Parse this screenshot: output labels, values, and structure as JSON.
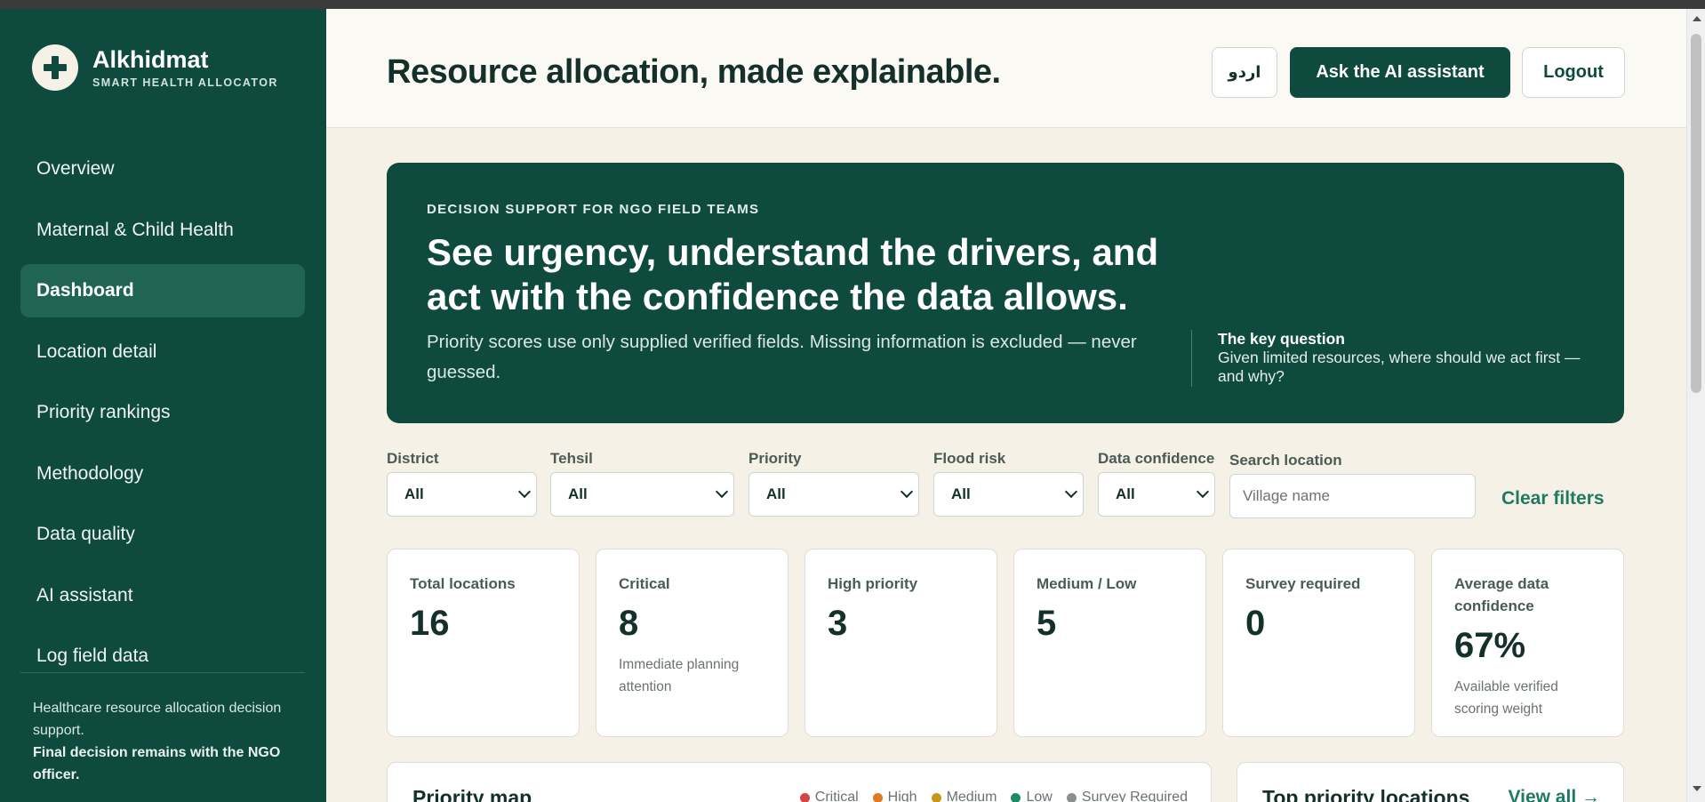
{
  "brand": {
    "name": "Alkhidmat",
    "subtitle": "SMART HEALTH ALLOCATOR"
  },
  "sidebar": {
    "items": [
      {
        "label": "Overview",
        "active": false
      },
      {
        "label": "Maternal & Child Health",
        "active": false
      },
      {
        "label": "Dashboard",
        "active": true
      },
      {
        "label": "Location detail",
        "active": false
      },
      {
        "label": "Priority rankings",
        "active": false
      },
      {
        "label": "Methodology",
        "active": false
      },
      {
        "label": "Data quality",
        "active": false
      },
      {
        "label": "AI assistant",
        "active": false
      },
      {
        "label": "Log field data",
        "active": false
      }
    ],
    "footer_text": "Healthcare resource allocation decision support.",
    "footer_strong": "Final decision remains with the NGO officer."
  },
  "header": {
    "title": "Resource allocation, made explainable.",
    "lang_label": "اردو",
    "ai_label": "Ask the AI assistant",
    "logout_label": "Logout"
  },
  "hero": {
    "kicker": "DECISION SUPPORT FOR NGO FIELD TEAMS",
    "title": "See urgency, understand the drivers, and act with the confidence the data allows.",
    "description": "Priority scores use only supplied verified fields. Missing information is excluded — never guessed.",
    "key_title": "The key question",
    "key_text": "Given limited resources, where should we act first — and why?"
  },
  "filters": {
    "district": {
      "label": "District",
      "value": "All"
    },
    "tehsil": {
      "label": "Tehsil",
      "value": "All"
    },
    "priority": {
      "label": "Priority",
      "value": "All"
    },
    "flood_risk": {
      "label": "Flood risk",
      "value": "All"
    },
    "data_confidence": {
      "label": "Data confidence",
      "value": "All"
    },
    "search": {
      "label": "Search location",
      "placeholder": "Village name"
    },
    "clear_label": "Clear filters"
  },
  "stats": [
    {
      "label": "Total locations",
      "value": "16",
      "note": ""
    },
    {
      "label": "Critical",
      "value": "8",
      "note": "Immediate planning attention"
    },
    {
      "label": "High priority",
      "value": "3",
      "note": ""
    },
    {
      "label": "Medium / Low",
      "value": "5",
      "note": ""
    },
    {
      "label": "Survey required",
      "value": "0",
      "note": ""
    },
    {
      "label": "Average data confidence",
      "value": "67%",
      "note": "Available verified scoring weight"
    }
  ],
  "map_panel": {
    "title": "Priority map",
    "legend": [
      {
        "label": "Critical",
        "color": "#d64545"
      },
      {
        "label": "High",
        "color": "#e07a22"
      },
      {
        "label": "Medium",
        "color": "#c9961a"
      },
      {
        "label": "Low",
        "color": "#1f8a68"
      },
      {
        "label": "Survey Required",
        "color": "#8a8f8c"
      }
    ]
  },
  "top_panel": {
    "title": "Top priority locations",
    "view_all_label": "View all →"
  },
  "colors": {
    "sidebar": "#0f4a3f",
    "accent": "#1f7a62",
    "page_bg": "#f6f1e7"
  }
}
